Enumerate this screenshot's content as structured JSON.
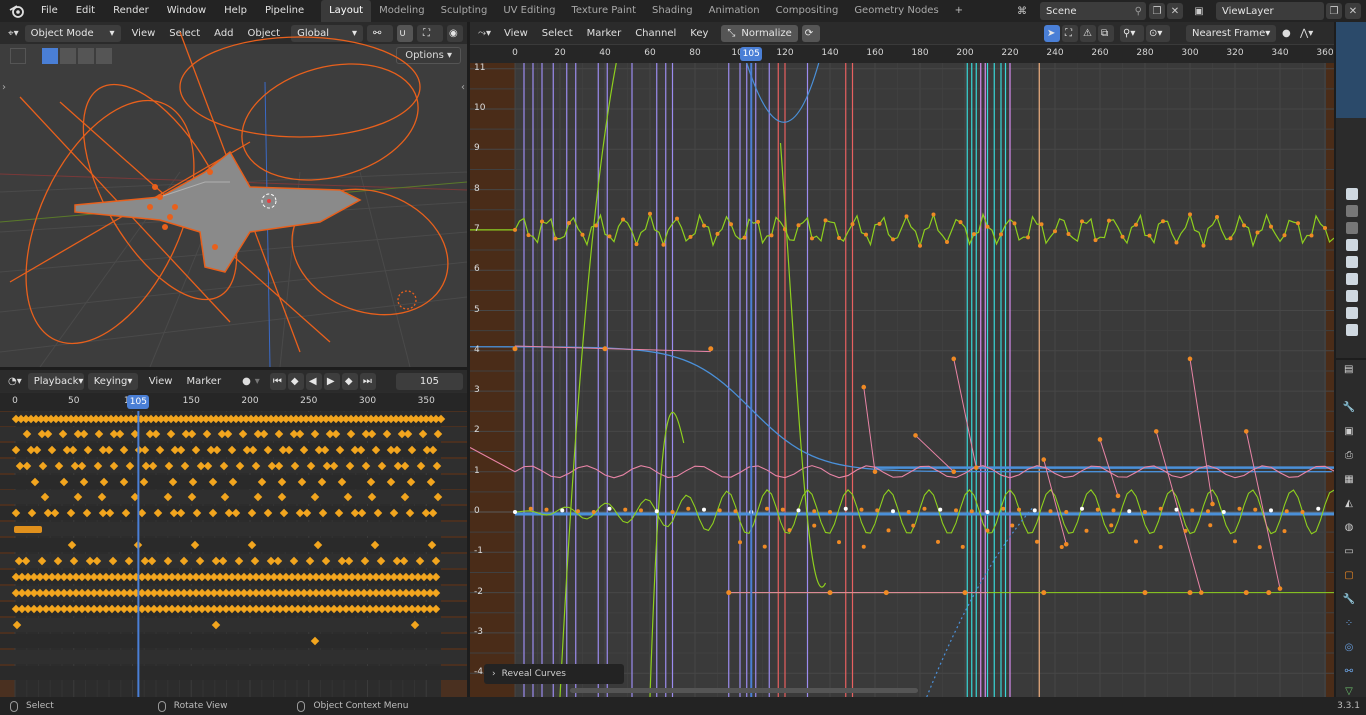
{
  "topbar": {
    "menu": [
      "File",
      "Edit",
      "Render",
      "Window",
      "Help",
      "Pipeline"
    ],
    "workspaces": [
      "Layout",
      "Modeling",
      "Sculpting",
      "UV Editing",
      "Texture Paint",
      "Shading",
      "Animation",
      "Compositing",
      "Geometry Nodes"
    ],
    "active_workspace": "Layout",
    "add_workspace": "+",
    "scene": "Scene",
    "view_layer": "ViewLayer"
  },
  "viewport": {
    "mode": "Object Mode",
    "menu": [
      "View",
      "Select",
      "Add",
      "Object"
    ],
    "orientation": "Global",
    "options_label": "Options"
  },
  "dopesheet": {
    "playback": "Playback",
    "keying": "Keying",
    "menu": [
      "View",
      "Marker"
    ],
    "current_frame": "105",
    "ruler_labels": [
      "0",
      "50",
      "100",
      "150",
      "200",
      "250",
      "300",
      "350"
    ],
    "ruler_values": [
      0,
      50,
      100,
      150,
      200,
      250,
      300,
      350
    ],
    "current_frame_badge": "105"
  },
  "graph": {
    "menu": [
      "View",
      "Select",
      "Marker",
      "Channel",
      "Key"
    ],
    "normalize_label": "Normalize",
    "snap_mode": "Nearest Frame",
    "ruler_labels": [
      "0",
      "20",
      "40",
      "60",
      "80",
      "100",
      "120",
      "140",
      "160",
      "180",
      "200",
      "220",
      "240",
      "260",
      "280",
      "300",
      "320",
      "340",
      "360"
    ],
    "ruler_values": [
      0,
      20,
      40,
      60,
      80,
      100,
      120,
      140,
      160,
      180,
      200,
      220,
      240,
      260,
      280,
      300,
      320,
      340,
      360
    ],
    "current_frame_badge": "105",
    "y_labels": [
      "11",
      "10",
      "9",
      "8",
      "7",
      "6",
      "5",
      "4",
      "3",
      "2",
      "1",
      "0",
      "-1",
      "-2",
      "-3",
      "-4"
    ],
    "y_values": [
      11,
      10,
      9,
      8,
      7,
      6,
      5,
      4,
      3,
      2,
      1,
      0,
      -1,
      -2,
      -3,
      -4
    ],
    "reveal_label": "Reveal Curves",
    "colors": {
      "key_orange": "#f08a24",
      "curve_green": "#8ecf1e",
      "curve_blue": "#4a90d9",
      "curve_pink": "#e884a6",
      "curve_purple": "#9c8cf0",
      "curve_cyan": "#38d8d8",
      "curve_red": "#e86060",
      "curve_peach": "#f0b080"
    }
  },
  "statusbar": {
    "select": "Select",
    "rotate": "Rotate View",
    "context_menu": "Object Context Menu",
    "version": "3.3.1"
  }
}
